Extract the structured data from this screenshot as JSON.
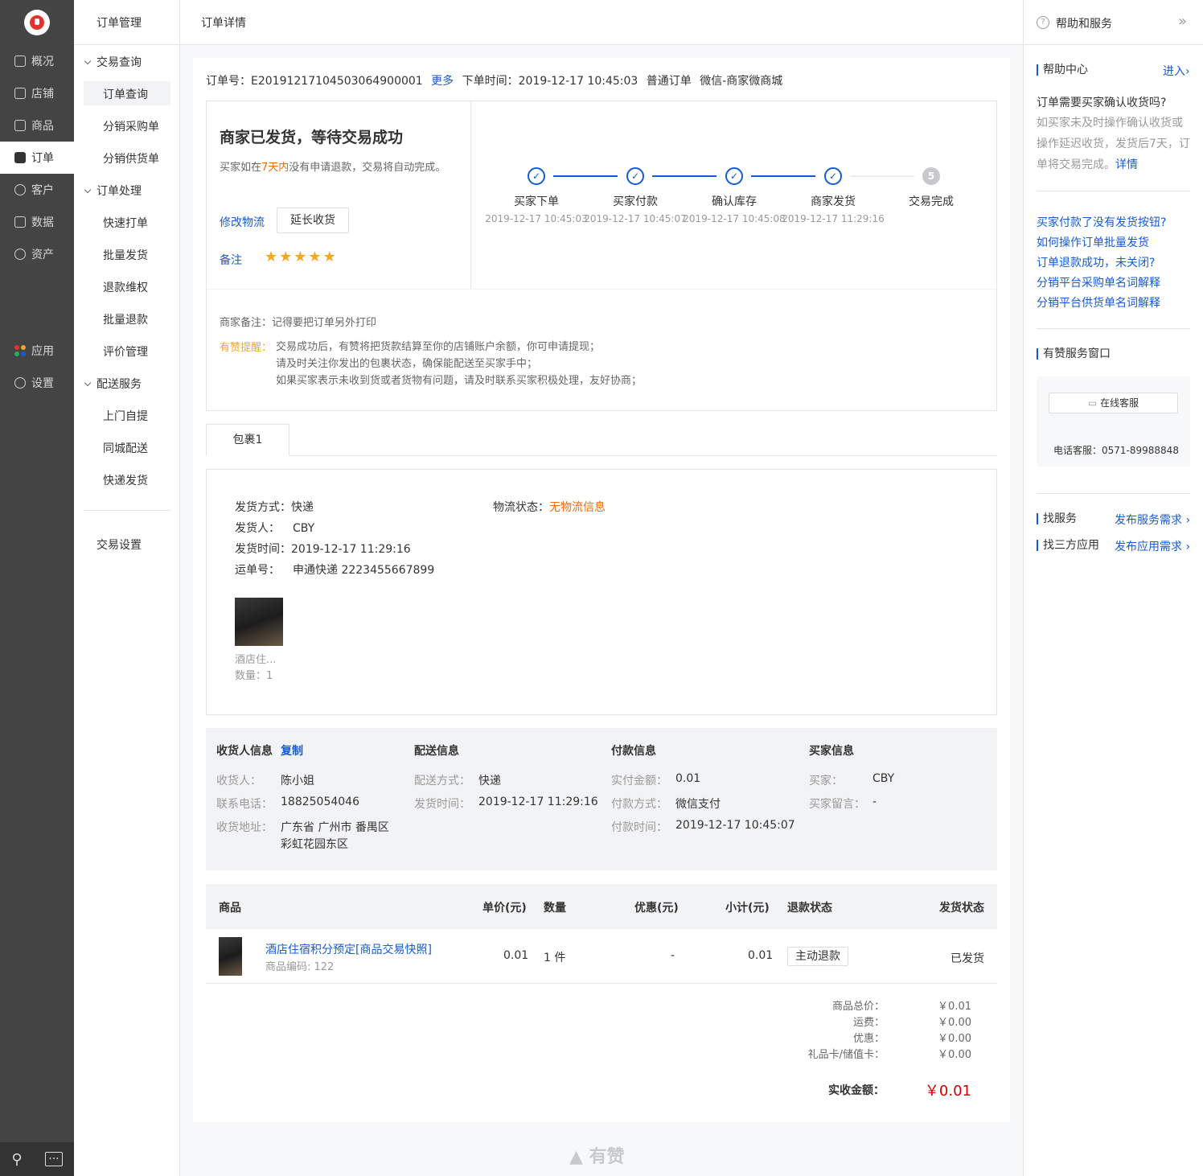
{
  "rail": {
    "items": [
      {
        "label": "概况",
        "icon": "chat-board-icon"
      },
      {
        "label": "店铺",
        "icon": "shop-icon"
      },
      {
        "label": "商品",
        "icon": "tag-icon"
      },
      {
        "label": "订单",
        "icon": "order-icon"
      },
      {
        "label": "客户",
        "icon": "user-icon"
      },
      {
        "label": "数据",
        "icon": "bar-chart-icon"
      },
      {
        "label": "资产",
        "icon": "yen-icon"
      },
      {
        "label": "应用",
        "icon": "apps-icon"
      },
      {
        "label": "设置",
        "icon": "gear-icon"
      }
    ]
  },
  "nav2": {
    "title": "订单管理",
    "groups": [
      "交易查询",
      "订单处理",
      "配送服务"
    ],
    "items": [
      "订单查询",
      "分销采购单",
      "分销供货单",
      "快速打单",
      "批量发货",
      "退款维权",
      "批量退款",
      "评价管理",
      "上门自提",
      "同城配送",
      "快递发货"
    ],
    "bottom": "交易设置"
  },
  "header": {
    "title": "订单详情"
  },
  "order": {
    "no_label": "订单号：",
    "no": "E20191217104503064900001",
    "more": "更多",
    "time_label": "下单时间：",
    "time": "2019-12-17 10:45:03",
    "type": "普通订单",
    "channel": "微信-商家微商城"
  },
  "status": {
    "title": "商家已发货，等待交易成功",
    "desc_pre": "买家如在",
    "desc_hl": "7天内",
    "desc_post": "没有申请退款，交易将自动完成。",
    "edit_logistics": "修改物流",
    "extend": "延长收货",
    "remark_label": "备注",
    "rating": 5
  },
  "steps": [
    {
      "label": "买家下单",
      "time": "2019-12-17 10:45:03",
      "done": true
    },
    {
      "label": "买家付款",
      "time": "2019-12-17 10:45:07",
      "done": true
    },
    {
      "label": "确认库存",
      "time": "2019-12-17 10:45:08",
      "done": true
    },
    {
      "label": "商家发货",
      "time": "2019-12-17 11:29:16",
      "done": true
    },
    {
      "label": "交易完成",
      "time": "",
      "done": false,
      "num": "5"
    }
  ],
  "notes": {
    "merchant_label": "商家备注：",
    "merchant": "记得要把订单另外打印",
    "reminder_label": "有赞提醒：",
    "lines": [
      "交易成功后，有赞将把货款结算至你的店铺账户余额，你可申请提现；",
      "请及时关注你发出的包裹状态，确保能配送至买家手中；",
      "如果买家表示未收到货或者货物有问题，请及时联系买家积极处理，友好协商；"
    ]
  },
  "package": {
    "tab": "包裹1",
    "method_label": "发货方式：",
    "method": "快递",
    "sender_label": "发货人：",
    "sender": "CBY",
    "time_label": "发货时间：",
    "time": "2019-12-17 11:29:16",
    "waybill_label": "运单号：",
    "waybill": "申通快递 2223455667899",
    "logi_label": "物流状态：",
    "logi": "无物流信息",
    "item_name": "酒店住...",
    "item_qty": "数量：1"
  },
  "info": {
    "receiver": {
      "title": "收货人信息",
      "copy": "复制",
      "name_label": "收货人：",
      "name": "陈小姐",
      "phone_label": "联系电话：",
      "phone": "18825054046",
      "addr_label": "收货地址：",
      "addr1": "广东省 广州市 番禺区",
      "addr2": "彩虹花园东区"
    },
    "delivery": {
      "title": "配送信息",
      "method_label": "配送方式：",
      "method": "快递",
      "time_label": "发货时间：",
      "time": "2019-12-17 11:29:16"
    },
    "payment": {
      "title": "付款信息",
      "amount_label": "实付金额：",
      "amount": "0.01",
      "method_label": "付款方式：",
      "method": "微信支付",
      "time_label": "付款时间：",
      "time": "2019-12-17 10:45:07"
    },
    "buyer": {
      "title": "买家信息",
      "buyer_label": "买家：",
      "buyer": "CBY",
      "msg_label": "买家留言：",
      "msg": "-"
    }
  },
  "table": {
    "headers": {
      "goods": "商品",
      "price": "单价(元)",
      "qty": "数量",
      "discount": "优惠(元)",
      "subtotal": "小计(元)",
      "refund": "退款状态",
      "ship": "发货状态"
    },
    "row": {
      "name": "酒店住宿积分预定[商品交易快照]",
      "code": "商品编码: 122",
      "price": "0.01",
      "qty": "1 件",
      "discount": "-",
      "subtotal": "0.01",
      "refund_btn": "主动退款",
      "ship": "已发货"
    }
  },
  "summary": {
    "goods_label": "商品总价：",
    "goods": "￥0.01",
    "freight_label": "运费：",
    "freight": "￥0.00",
    "discount_label": "优惠：",
    "discount": "￥0.00",
    "card_label": "礼品卡/储值卡：",
    "card": "￥0.00",
    "total_label": "实收金额：",
    "total": "￥0.01"
  },
  "footer": {
    "brand": "有赞"
  },
  "help": {
    "title": "帮助和服务",
    "center": "帮助中心",
    "enter": "进入",
    "q": "订单需要买家确认收货吗?",
    "a": "如买家未及时操作确认收货或操作延迟收货，发货后7天，订单将交易完成。",
    "detail": "详情",
    "links": [
      "买家付款了没有发货按钮?",
      "如何操作订单批量发货",
      "订单退款成功，未关闭?",
      "分销平台采购单名词解释",
      "分销平台供货单名词解释"
    ],
    "service_title": "有赞服务窗口",
    "online": "在线客服",
    "phone": "电话客服：0571-89988848",
    "find_service": "找服务",
    "post_service": "发布服务需求",
    "find_app": "找三方应用",
    "post_app": "发布应用需求"
  },
  "colors": {
    "accent": "#155bd4",
    "orange": "#ed6a0c",
    "red": "#d40000",
    "rail": "#444444"
  }
}
